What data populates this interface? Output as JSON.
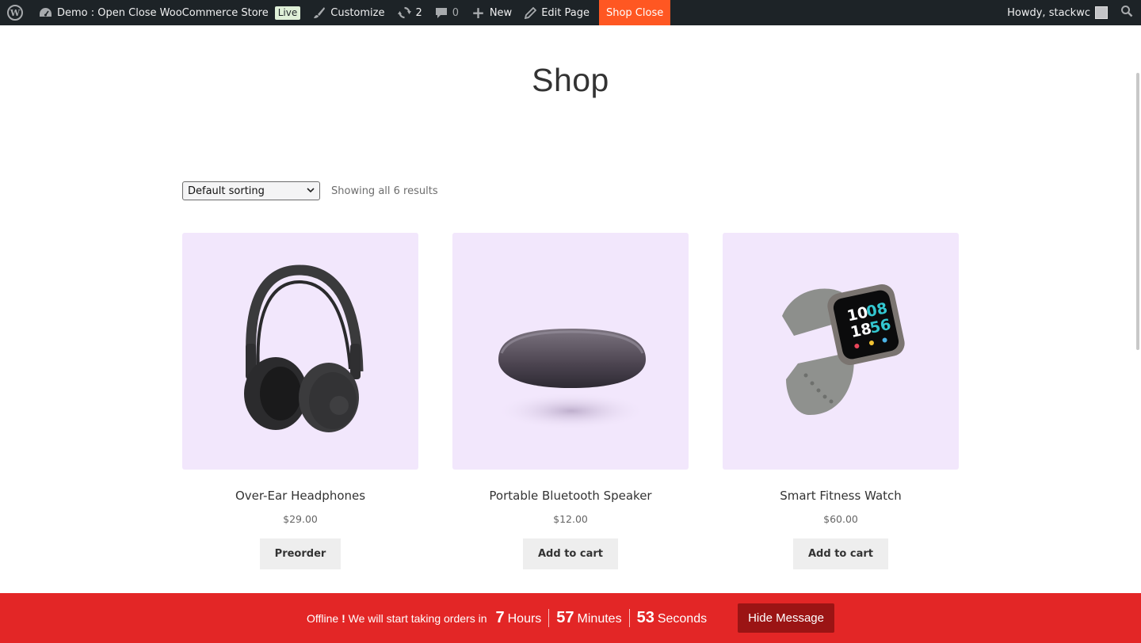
{
  "adminbar": {
    "site_name": "Demo : Open Close WooCommerce Store",
    "live_badge": "Live",
    "customize": "Customize",
    "updates_count": "2",
    "comments_count": "0",
    "new": "New",
    "edit_page": "Edit Page",
    "shop_close": "Shop Close",
    "greeting": "Howdy, stackwc"
  },
  "page": {
    "title": "Shop"
  },
  "toolbar": {
    "sort_selected": "Default sorting",
    "result_count": "Showing all 6 results"
  },
  "products": [
    {
      "name": "Over-Ear Headphones",
      "price": "$29.00",
      "button": "Preorder",
      "image": "headphones"
    },
    {
      "name": "Portable Bluetooth Speaker",
      "price": "$12.00",
      "button": "Add to cart",
      "image": "speaker"
    },
    {
      "name": "Smart Fitness Watch",
      "price": "$60.00",
      "button": "Add to cart",
      "image": "smartwatch"
    }
  ],
  "watch_face": {
    "hour": "10",
    "minute": "08",
    "line2_left": "18",
    "line2_right": "56"
  },
  "notice": {
    "text_before": "Offline",
    "exclaim": "!",
    "text_after": "We will start taking orders in",
    "hours_value": "7",
    "hours_label": "Hours",
    "minutes_value": "57",
    "minutes_label": "Minutes",
    "seconds_value": "53",
    "seconds_label": "Seconds",
    "hide_button": "Hide Message"
  },
  "colors": {
    "adminbar_bg": "#1d2327",
    "shop_close_bg": "#ff5722",
    "notice_bg": "#e32626",
    "hide_button_bg": "#9b1414",
    "product_bg": "#f2e7fc"
  }
}
